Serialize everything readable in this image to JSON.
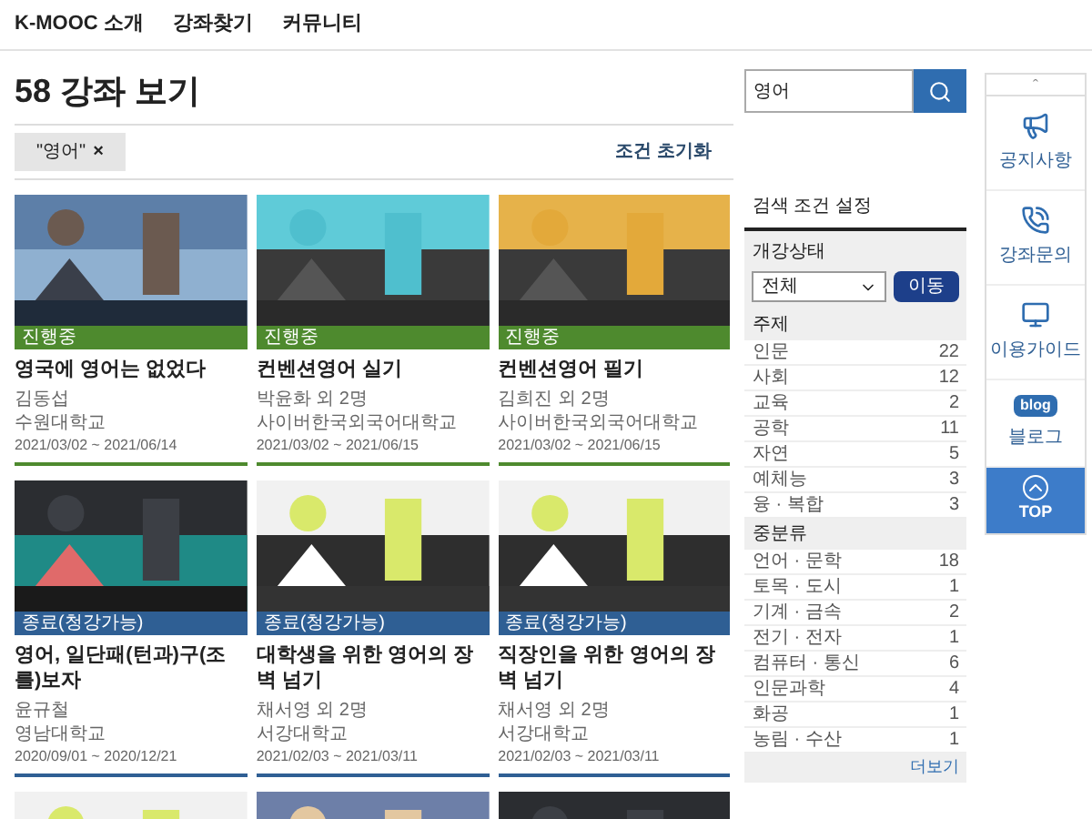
{
  "nav": [
    "K-MOOC 소개",
    "강좌찾기",
    "커뮤니티"
  ],
  "heading": "58 강좌 보기",
  "search": {
    "value": "영어"
  },
  "filter_chip": {
    "label": "\"영어\"",
    "remove": "×"
  },
  "reset_link": "조건 초기화",
  "courses": [
    {
      "status": "진행중",
      "color": "#4e8a2e",
      "title": "영국에 영어는 없었다",
      "author": "김동섭",
      "school": "수원대학교",
      "dates": "2021/03/02 ~ 2021/06/14"
    },
    {
      "status": "진행중",
      "color": "#4e8a2e",
      "title": "컨벤션영어 실기",
      "author": "박윤화 외 2명",
      "school": "사이버한국외국어대학교",
      "dates": "2021/03/02 ~ 2021/06/15"
    },
    {
      "status": "진행중",
      "color": "#4e8a2e",
      "title": "컨벤션영어 필기",
      "author": "김희진 외 2명",
      "school": "사이버한국외국어대학교",
      "dates": "2021/03/02 ~ 2021/06/15"
    },
    {
      "status": "종료(청강가능)",
      "color": "#2f5f94",
      "title": "영어, 일단패(턴과)구(조를)보자",
      "author": "윤규철",
      "school": "영남대학교",
      "dates": "2020/09/01 ~ 2020/12/21"
    },
    {
      "status": "종료(청강가능)",
      "color": "#2f5f94",
      "title": "대학생을 위한 영어의 장벽 넘기",
      "author": "채서영 외 2명",
      "school": "서강대학교",
      "dates": "2021/02/03 ~ 2021/03/11"
    },
    {
      "status": "종료(청강가능)",
      "color": "#2f5f94",
      "title": "직장인을 위한 영어의 장벽 넘기",
      "author": "채서영 외 2명",
      "school": "서강대학교",
      "dates": "2021/02/03 ~ 2021/03/11"
    }
  ],
  "more_courses": [
    {
      "kind": "picture"
    },
    {
      "kind": "picture"
    },
    {
      "kind": "picture"
    }
  ],
  "filters": {
    "title": "검색 조건 설정",
    "status_section": "개강상태",
    "status_select": "전체",
    "status_button": "이동",
    "groups": [
      {
        "title": "주제",
        "items": [
          {
            "label": "인문",
            "count": "22"
          },
          {
            "label": "사회",
            "count": "12"
          },
          {
            "label": "교육",
            "count": "2"
          },
          {
            "label": "공학",
            "count": "11"
          },
          {
            "label": "자연",
            "count": "5"
          },
          {
            "label": "예체능",
            "count": "3"
          },
          {
            "label": "융 · 복합",
            "count": "3"
          }
        ]
      },
      {
        "title": "중분류",
        "items": [
          {
            "label": "언어 · 문학",
            "count": "18"
          },
          {
            "label": "토목 · 도시",
            "count": "1"
          },
          {
            "label": "기계 · 금속",
            "count": "2"
          },
          {
            "label": "전기 · 전자",
            "count": "1"
          },
          {
            "label": "컴퓨터 · 통신",
            "count": "6"
          },
          {
            "label": "인문과학",
            "count": "4"
          },
          {
            "label": "화공",
            "count": "1"
          },
          {
            "label": "농림 · 수산",
            "count": "1"
          }
        ]
      }
    ],
    "more": "더보기"
  },
  "quick_menu": {
    "up": "ˆ",
    "items": [
      {
        "kind": "megaphone",
        "label": "공지사항"
      },
      {
        "kind": "phone",
        "label": "강좌문의"
      },
      {
        "kind": "monitor",
        "label": "이용가이드"
      },
      {
        "kind": "blog",
        "label": "블로그",
        "badge": "blog"
      }
    ],
    "top": "TOP"
  }
}
